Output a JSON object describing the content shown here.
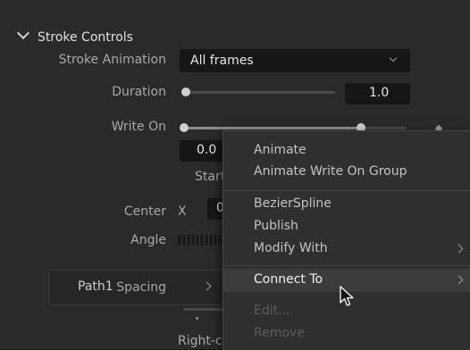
{
  "section": {
    "title": "Stroke Controls"
  },
  "stroke_animation": {
    "label": "Stroke Animation",
    "value": "All frames"
  },
  "duration": {
    "label": "Duration",
    "value": "1.0",
    "level": 0.0
  },
  "write_on": {
    "label": "Write On",
    "start_value": "0.0",
    "start_label": "Start",
    "level_start": 0.0,
    "level_end": 1.0
  },
  "center": {
    "label": "Center",
    "axis": "X",
    "value_partial": "0"
  },
  "angle": {
    "label": "Angle"
  },
  "path": {
    "label": "Path1"
  },
  "spacing": {
    "label": "Spacing"
  },
  "footer_partial": "Right-cl",
  "context_menu": {
    "items": [
      {
        "label": "Animate"
      },
      {
        "label": "Animate Write On Group"
      },
      {
        "label": "BezierSpline"
      },
      {
        "label": "Publish"
      },
      {
        "label": "Modify With"
      },
      {
        "label": "Connect To"
      },
      {
        "label": "Edit..."
      },
      {
        "label": "Remove"
      }
    ]
  },
  "colors": {
    "panel": "#2a2a2a",
    "field": "#161616",
    "menu": "#2f2f2f",
    "highlight": "#3c3c3c"
  },
  "icons": [
    "chevron-down-icon",
    "chevron-right-icon",
    "keyframe-diamond-icon",
    "mouse-cursor-icon"
  ]
}
